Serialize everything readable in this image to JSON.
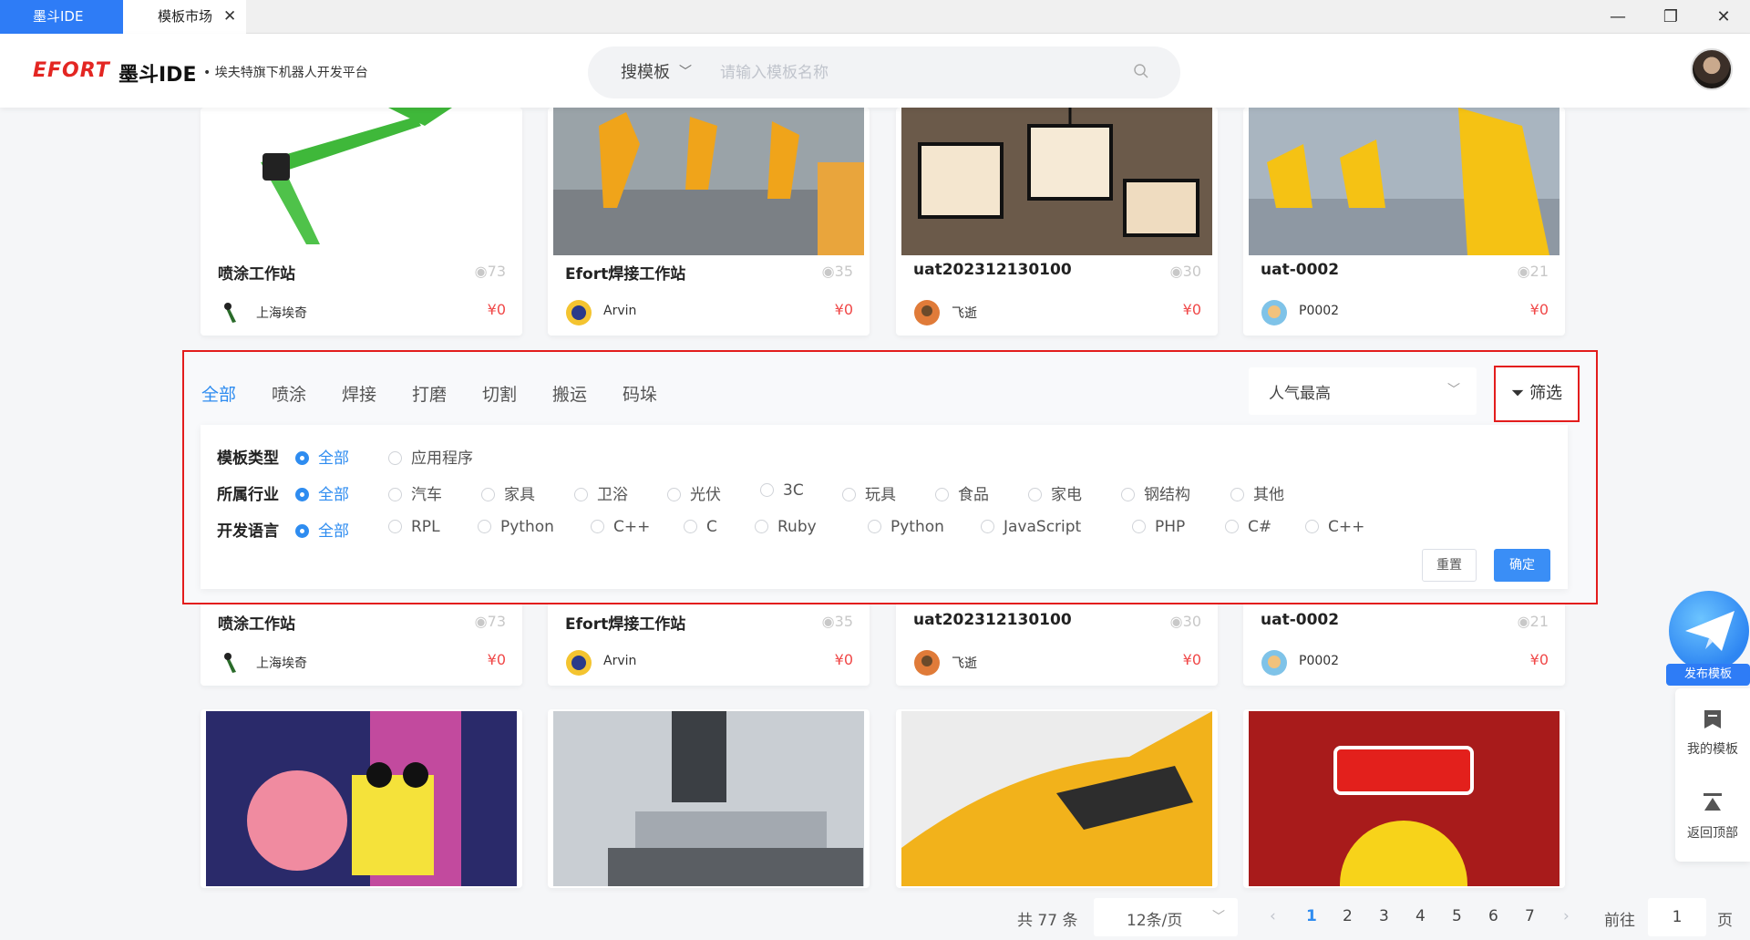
{
  "window": {
    "app_tab": "墨斗IDE",
    "active_tab": "模板市场",
    "close_glyph": "✕",
    "controls": [
      "—",
      "❐",
      "✕"
    ]
  },
  "header": {
    "brand": "EFORT",
    "product": "墨斗IDE",
    "tagline": "• 埃夫特旗下机器人开发平台",
    "search_type": "搜模板",
    "search_placeholder": "请输入模板名称"
  },
  "cards_top": [
    {
      "title": "喷涂工作站",
      "views": "73",
      "author": "上海埃奇",
      "price": "¥0"
    },
    {
      "title": "Efort焊接工作站",
      "views": "35",
      "author": "Arvin",
      "price": "¥0"
    },
    {
      "title": "uat202312130100",
      "views": "30",
      "author": "飞逝",
      "price": "¥0"
    },
    {
      "title": "uat-0002",
      "views": "21",
      "author": "P0002",
      "price": "¥0"
    }
  ],
  "cards_mid": [
    {
      "title": "喷涂工作站",
      "views": "73",
      "author": "上海埃奇",
      "price": "¥0"
    },
    {
      "title": "Efort焊接工作站",
      "views": "35",
      "author": "Arvin",
      "price": "¥0"
    },
    {
      "title": "uat202312130100",
      "views": "30",
      "author": "飞逝",
      "price": "¥0"
    },
    {
      "title": "uat-0002",
      "views": "21",
      "author": "P0002",
      "price": "¥0"
    }
  ],
  "filter": {
    "categories": [
      "全部",
      "喷涂",
      "焊接",
      "打磨",
      "切割",
      "搬运",
      "码垛"
    ],
    "active_category": "全部",
    "sort_value": "人气最高",
    "filter_label": "筛选",
    "rows": [
      {
        "label": "模板类型",
        "options": [
          "全部",
          "应用程序"
        ]
      },
      {
        "label": "所属行业",
        "options": [
          "全部",
          "汽车",
          "家具",
          "卫浴",
          "光伏",
          "3C",
          "玩具",
          "食品",
          "家电",
          "钢结构",
          "其他"
        ]
      },
      {
        "label": "开发语言",
        "options": [
          "全部",
          "RPL",
          "Python",
          "C++",
          "C",
          "Ruby",
          "Python",
          "JavaScript",
          "PHP",
          "C#",
          "C++"
        ]
      }
    ],
    "reset_label": "重置",
    "confirm_label": "确定"
  },
  "side": {
    "publish_label": "发布模板",
    "my_templates_label": "我的模板",
    "back_top_label": "返回顶部"
  },
  "pagination": {
    "total": "共 77 条",
    "page_size": "12条/页",
    "pages": [
      "1",
      "2",
      "3",
      "4",
      "5",
      "6",
      "7"
    ],
    "current_page": "1",
    "prev_glyph": "‹",
    "next_glyph": "›",
    "goto_label": "前往",
    "goto_value": "1",
    "page_suffix": "页"
  },
  "colors": {
    "accent": "#2e8cf0",
    "brand_red": "#e32622",
    "highlight_red": "#e31d1d",
    "price": "#f04848"
  }
}
